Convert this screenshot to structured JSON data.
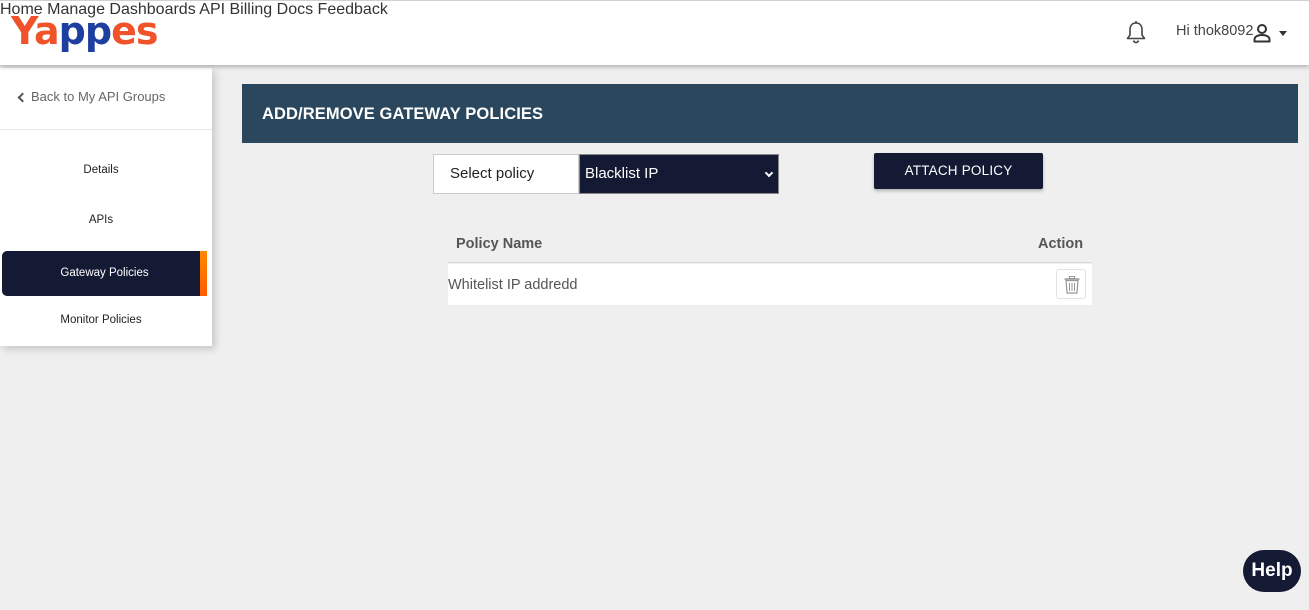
{
  "header": {
    "logo_text_a": "Ya",
    "logo_text_b": "pp",
    "logo_text_c": "es",
    "nav": [
      {
        "label": "Home"
      },
      {
        "label": "Manage"
      },
      {
        "label": "Dashboards"
      },
      {
        "label": "API Billing"
      },
      {
        "label": "Docs"
      },
      {
        "label": "Feedback"
      }
    ],
    "bell_icon": "bell-icon",
    "user_greeting": "Hi thok8092",
    "user_icon": "user-icon",
    "caret_icon": "caret-down-icon"
  },
  "sidebar": {
    "back_label": "Back to My API Groups",
    "items": [
      {
        "label": "Details",
        "active": false
      },
      {
        "label": "APIs",
        "active": false
      },
      {
        "label": "Gateway Policies",
        "active": true
      },
      {
        "label": "Monitor Policies",
        "active": false
      }
    ]
  },
  "main": {
    "title": "ADD/REMOVE GATEWAY POLICIES",
    "select_label": "Select policy",
    "select_value": "Blacklist IP",
    "attach_button": "ATTACH POLICY",
    "table": {
      "columns": [
        "Policy Name",
        "Action"
      ],
      "rows": [
        {
          "name": "Whitelist IP addredd",
          "action_icon": "trash-icon"
        }
      ]
    }
  },
  "help_label": "Help",
  "colors": {
    "brand_orange": "#f0522a",
    "brand_blue": "#1d3fa0",
    "navy": "#141a33",
    "panel_header": "#2a475d",
    "active_accent": "#ff8a00"
  }
}
